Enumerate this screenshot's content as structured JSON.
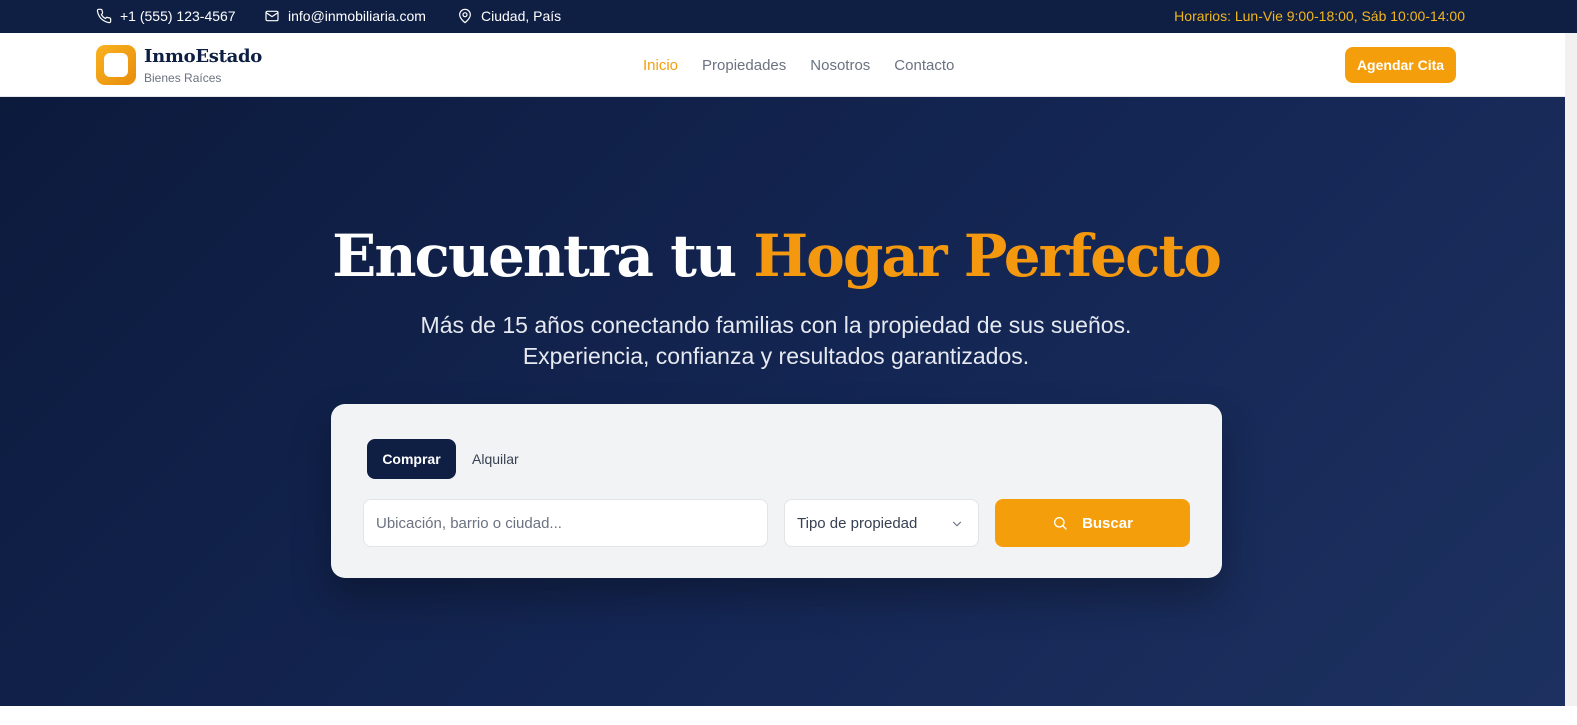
{
  "topbar": {
    "phone": "+1 (555) 123-4567",
    "phone_icon": "phone-icon",
    "email": "info@inmobiliaria.com",
    "email_icon": "mail-icon",
    "location": "Ciudad, País",
    "location_icon": "map-pin-icon",
    "hours": "Horarios: Lun-Vie 9:00-18:00, Sáb 10:00-14:00"
  },
  "nav": {
    "brand": "InmoEstado",
    "brand_sub": "Bienes Raíces",
    "links": [
      "Inicio",
      "Propiedades",
      "Nosotros",
      "Contacto"
    ],
    "active_link": "Inicio",
    "cta": "Agendar Cita"
  },
  "hero": {
    "title_main": "Encuentra tu ",
    "title_accent": "Hogar Perfecto",
    "subtitle_line1": "Más de 15 años conectando familias con la propiedad de sus sueños.",
    "subtitle_line2": "Experiencia, confianza y resultados garantizados."
  },
  "search": {
    "tabs": [
      "Comprar",
      "Alquilar"
    ],
    "active_tab": "Comprar",
    "location_placeholder": "Ubicación, barrio o ciudad...",
    "location_value": "",
    "type_selected": "Tipo de propiedad",
    "button": "Buscar",
    "button_icon": "search-icon"
  },
  "colors": {
    "navy": "#0f1f44",
    "accent": "#f59e0b",
    "hours_text": "#f2b51c"
  }
}
